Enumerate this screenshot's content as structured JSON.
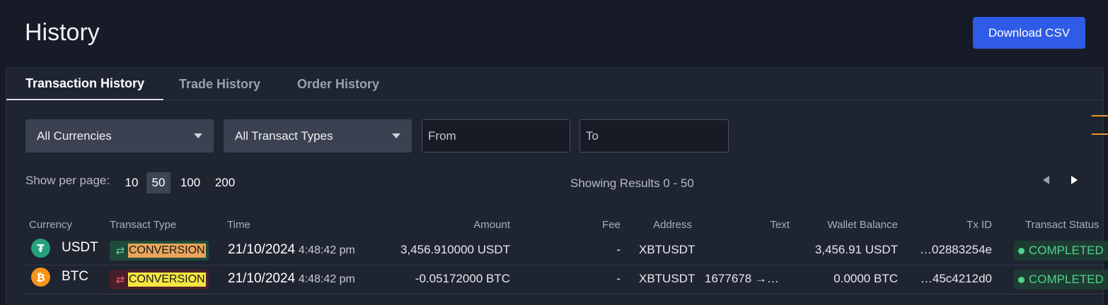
{
  "header": {
    "title": "History",
    "download_label": "Download CSV"
  },
  "tabs": [
    {
      "label": "Transaction History",
      "active": true
    },
    {
      "label": "Trade History",
      "active": false
    },
    {
      "label": "Order History",
      "active": false
    }
  ],
  "filters": {
    "currency": "All Currencies",
    "type": "All Transact Types",
    "from_placeholder": "From",
    "to_placeholder": "To"
  },
  "pagination": {
    "per_page_label": "Show per page:",
    "options": [
      "10",
      "50",
      "100",
      "200"
    ],
    "selected": "50",
    "results_text": "Showing Results 0 - 50"
  },
  "table": {
    "columns": [
      "Currency",
      "Transact Type",
      "Time",
      "Amount",
      "Fee",
      "Address",
      "Text",
      "Wallet Balance",
      "Tx ID",
      "Transact Status"
    ],
    "rows": [
      {
        "currency": "USDT",
        "coin_icon": "tether-icon",
        "coin_color": "#26a17b",
        "coin_glyph": "₮",
        "type": "CONVERSION",
        "type_bg": "#1f4a3a",
        "type_arrow_color": "#5bd08f",
        "type_label_bg": "#e9a55a",
        "date": "21/10/2024",
        "time": "4:48:42 pm",
        "amount": "3,456.910000 USDT",
        "fee": "-",
        "address": "XBTUSDT",
        "text": "",
        "balance": "3,456.91 USDT",
        "txid": "…02883254e",
        "status": "COMPLETED"
      },
      {
        "currency": "BTC",
        "coin_icon": "bitcoin-icon",
        "coin_color": "#f7931a",
        "coin_glyph": "₿",
        "type": "CONVERSION",
        "type_bg": "#4a1f2b",
        "type_arrow_color": "#ef5b6b",
        "type_label_bg": "#f5e642",
        "date": "21/10/2024",
        "time": "4:48:42 pm",
        "amount": "-0.05172000 BTC",
        "fee": "-",
        "address": "XBTUSDT",
        "text": "1677678 →…",
        "balance": "0.0000 BTC",
        "txid": "…45c4212d0",
        "status": "COMPLETED"
      }
    ]
  }
}
